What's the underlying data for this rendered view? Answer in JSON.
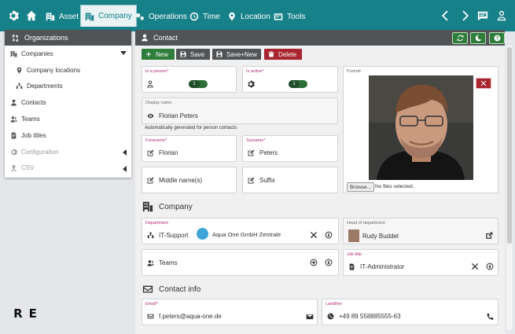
{
  "nav": {
    "asset": "Asset",
    "company": "Company",
    "operations": "Operations",
    "time": "Time",
    "location": "Location",
    "tools": "Tools"
  },
  "sidebar": {
    "title": "Organizations",
    "items": [
      {
        "label": "Companies"
      },
      {
        "label": "Company locations"
      },
      {
        "label": "Departments"
      },
      {
        "label": "Contacts"
      },
      {
        "label": "Teams"
      },
      {
        "label": "Job titles"
      },
      {
        "label": "Configuration"
      },
      {
        "label": "CSV"
      }
    ]
  },
  "logo": {
    "text": "RE"
  },
  "contact": {
    "title": "Contact",
    "toolbar": {
      "new": "New",
      "save": "Save",
      "save_new": "Save+New",
      "delete": "Delete"
    },
    "is_person_label": "Is a person*",
    "is_person_value": "1",
    "is_active_label": "Is active*",
    "is_active_value": "1",
    "display_name_label": "Display name",
    "display_name": "Florian Peters",
    "display_hint": "Automatically generated for person contacts",
    "forename_label": "Forename*",
    "forename": "Florian",
    "surname_label": "Surname*",
    "surname": "Peters",
    "middle_placeholder": "Middle name(s)",
    "suffix_placeholder": "Suffix",
    "portrait_label": "Portrait",
    "browse": "Browse...",
    "no_files": "No files selected."
  },
  "company_section": {
    "title": "Company",
    "department_label": "Department",
    "department": "IT-Support",
    "company_name": "Aqua One GmbH Zentrale",
    "head_label": "Head of department",
    "head": "Rudy Buddel",
    "teams_placeholder": "Teams",
    "job_title_label": "Job title",
    "job_title": "IT-Administrator"
  },
  "contact_info": {
    "title": "Contact info",
    "email_label": "Email*",
    "email": "f.peters@aqua-one.de",
    "landline_label": "Landline",
    "landline": "+49 89 558885555-63"
  },
  "colors": {
    "nav_bg": "#17818a",
    "header_bg": "#505456",
    "accent_green": "#2f7d3b",
    "delete_red": "#a8252f",
    "label_pink": "#b0286d"
  }
}
